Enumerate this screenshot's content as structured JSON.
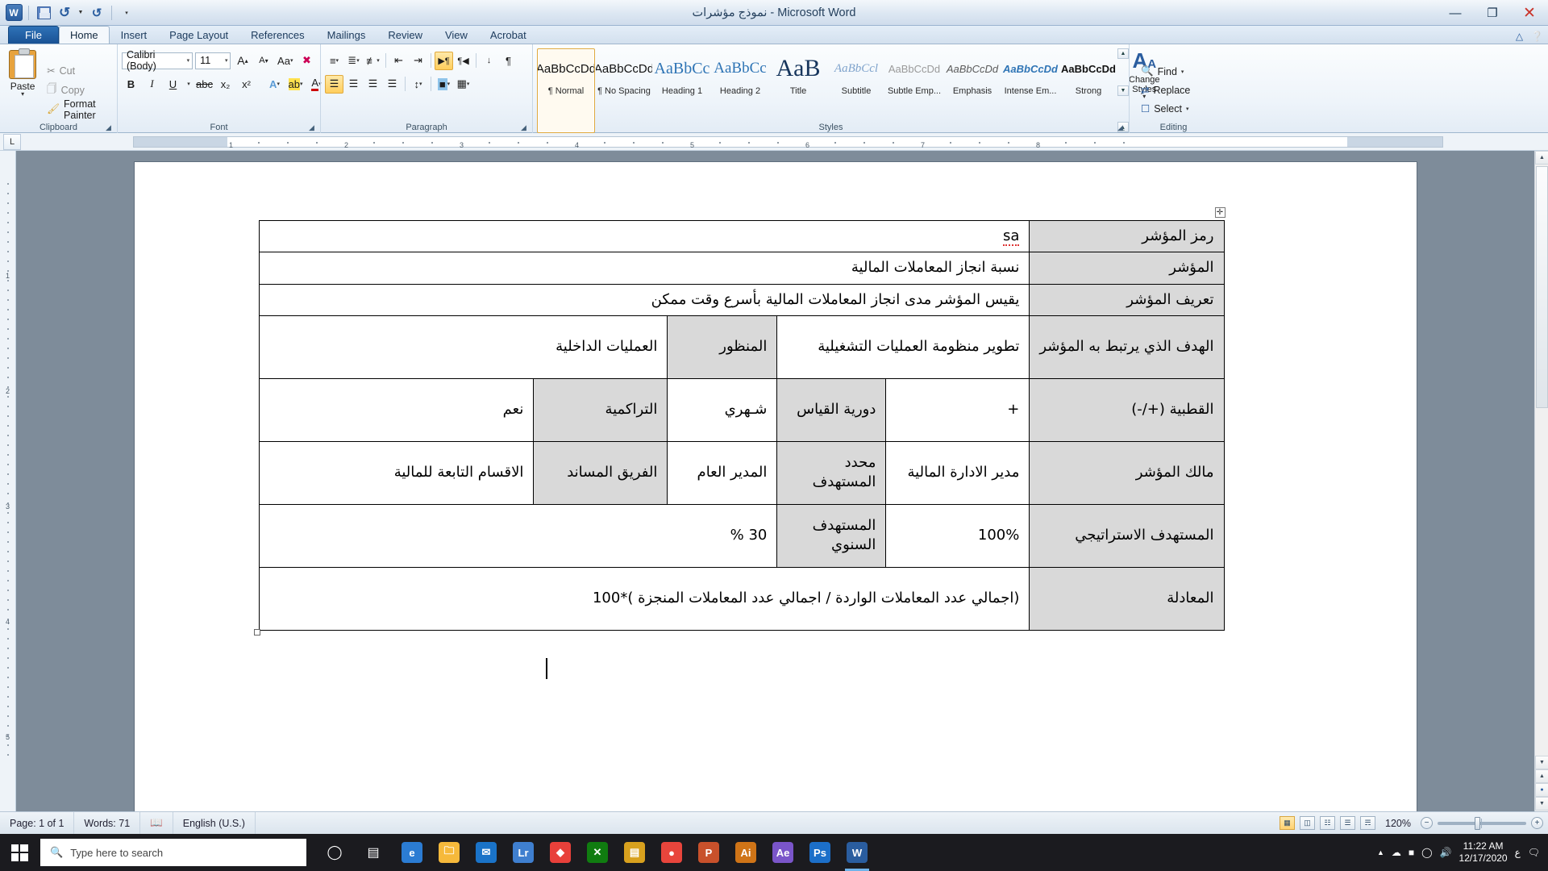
{
  "titlebar": {
    "title": "نموذج مؤشرات - Microsoft Word",
    "qat": {
      "word_logo": "W",
      "save": "save-icon",
      "undo": "undo-icon",
      "redo": "redo-icon",
      "customize": "customize-qat-icon"
    },
    "controls": {
      "minimize": "—",
      "restore": "❐",
      "close": "✕"
    }
  },
  "tabs": [
    {
      "label": "File",
      "active": false,
      "file": true
    },
    {
      "label": "Home",
      "active": true
    },
    {
      "label": "Insert",
      "active": false
    },
    {
      "label": "Page Layout",
      "active": false
    },
    {
      "label": "References",
      "active": false
    },
    {
      "label": "Mailings",
      "active": false
    },
    {
      "label": "Review",
      "active": false
    },
    {
      "label": "View",
      "active": false
    },
    {
      "label": "Acrobat",
      "active": false
    }
  ],
  "ribbon": {
    "clipboard": {
      "group_label": "Clipboard",
      "paste": "Paste",
      "cut": "Cut",
      "copy": "Copy",
      "format_painter": "Format Painter"
    },
    "font": {
      "group_label": "Font",
      "font_name": "Calibri (Body)",
      "font_size": "11",
      "grow": "A",
      "shrink": "A",
      "change_case": "Aa",
      "clear_formatting": "clear-formatting-icon",
      "bold": "B",
      "italic": "I",
      "underline": "U",
      "strikethrough": "abc",
      "subscript": "x₂",
      "superscript": "x²",
      "text_effects": "A",
      "highlight": "ab",
      "font_color": "A"
    },
    "paragraph": {
      "group_label": "Paragraph",
      "bullets": "bullets-icon",
      "numbering": "numbering-icon",
      "multilevel": "multilevel-list-icon",
      "decrease_indent": "decrease-indent-icon",
      "increase_indent": "increase-indent-icon",
      "ltr": "left-to-right-icon",
      "rtl": "right-to-left-icon",
      "sort": "sort-icon",
      "show_marks": "¶",
      "align_left": "align-left-icon",
      "align_center": "align-center-icon",
      "align_right": "align-right-icon",
      "justify": "justify-icon",
      "line_spacing": "line-spacing-icon",
      "shading": "shading-icon",
      "borders": "borders-icon"
    },
    "styles": {
      "group_label": "Styles",
      "items": [
        {
          "preview": "AaBbCcDd",
          "name": "¶ Normal",
          "selected": true
        },
        {
          "preview": "AaBbCcDd",
          "name": "¶ No Spacing",
          "selected": false
        },
        {
          "preview": "AaBbCc",
          "name": "Heading 1",
          "selected": false
        },
        {
          "preview": "AaBbCc",
          "name": "Heading 2",
          "selected": false
        },
        {
          "preview": "AaB",
          "name": "Title",
          "selected": false
        },
        {
          "preview": "AaBbCcl",
          "name": "Subtitle",
          "selected": false
        },
        {
          "preview": "AaBbCcDd",
          "name": "Subtle Emp...",
          "selected": false
        },
        {
          "preview": "AaBbCcDd",
          "name": "Emphasis",
          "selected": false
        },
        {
          "preview": "AaBbCcDd",
          "name": "Intense Em...",
          "selected": false
        },
        {
          "preview": "AaBbCcDd",
          "name": "Strong",
          "selected": false
        }
      ],
      "change_styles": "Change Styles"
    },
    "editing": {
      "group_label": "Editing",
      "find": "Find",
      "replace": "Replace",
      "select": "Select"
    }
  },
  "ruler": {
    "tab_selector": "L",
    "ticks": [
      "1",
      "2",
      "3",
      "4",
      "5",
      "6",
      "7",
      "8"
    ],
    "vticks": [
      "1",
      "2",
      "3",
      "4",
      "5"
    ]
  },
  "document": {
    "table": [
      {
        "cells": [
          {
            "text": "رمز المؤشر",
            "type": "label",
            "width": 170
          },
          {
            "text": "sa",
            "type": "value",
            "colspan": 5,
            "spell": true
          }
        ]
      },
      {
        "cells": [
          {
            "text": "المؤشر",
            "type": "label"
          },
          {
            "text": "نسبة انجاز المعاملات المالية",
            "type": "value",
            "colspan": 5
          }
        ]
      },
      {
        "cells": [
          {
            "text": "تعريف المؤشر",
            "type": "label"
          },
          {
            "text": "يقيس المؤشر مدى انجاز المعاملات المالية بأسرع وقت ممكن",
            "type": "value",
            "colspan": 5
          }
        ]
      },
      {
        "tall": true,
        "cells": [
          {
            "text": "الهدف الذي يرتبط به المؤشر",
            "type": "label"
          },
          {
            "text": "تطوير منظومة العمليات التشغيلية",
            "type": "value",
            "colspan": 2
          },
          {
            "text": "المنظور",
            "type": "shade"
          },
          {
            "text": "العمليات الداخلية",
            "type": "value",
            "colspan": 2
          }
        ]
      },
      {
        "tall": true,
        "cells": [
          {
            "text": "القطبية (+/-)",
            "type": "label"
          },
          {
            "text": "+",
            "type": "value"
          },
          {
            "text": "دورية القياس",
            "type": "shade"
          },
          {
            "text": "شـهري",
            "type": "value"
          },
          {
            "text": "التراكمية",
            "type": "shade"
          },
          {
            "text": "نعم",
            "type": "value"
          }
        ]
      },
      {
        "tall": true,
        "cells": [
          {
            "text": "مالك المؤشر",
            "type": "label"
          },
          {
            "text": "مدير الادارة المالية",
            "type": "value"
          },
          {
            "text": "محدد المستهدف",
            "type": "shade"
          },
          {
            "text": "المدير العام",
            "type": "value"
          },
          {
            "text": "الفريق المساند",
            "type": "shade"
          },
          {
            "text": "الاقسام التابعة للمالية",
            "type": "value"
          }
        ]
      },
      {
        "tall": true,
        "cells": [
          {
            "text": "المستهدف الاستراتيجي",
            "type": "label"
          },
          {
            "text": "100%",
            "type": "value"
          },
          {
            "text": "المستهدف السنوي",
            "type": "shade"
          },
          {
            "text": "30 %",
            "type": "value",
            "colspan": 3
          }
        ]
      },
      {
        "tall": true,
        "cells": [
          {
            "text": "المعادلة",
            "type": "label"
          },
          {
            "text": "(اجمالي عدد المعاملات الواردة / اجمالي عدد المعاملات المنجزة )*100",
            "type": "value",
            "colspan": 5
          }
        ]
      }
    ]
  },
  "statusbar": {
    "page": "Page: 1 of 1",
    "words": "Words: 71",
    "proofing_icon": "spelling-check-icon",
    "language": "English (U.S.)",
    "views": [
      "print-layout-icon",
      "full-screen-reading-icon",
      "web-layout-icon",
      "outline-icon",
      "draft-icon"
    ],
    "zoom": "120%",
    "zoom_out": "−",
    "zoom_in": "+"
  },
  "taskbar": {
    "start": "start-button",
    "search_placeholder": "Type here to search",
    "search_icon": "search-icon",
    "cortana": "cortana-icon",
    "task_view": "task-view-icon",
    "apps": [
      {
        "name": "edge-icon",
        "glyph": "e",
        "color": "#2b7cd3"
      },
      {
        "name": "file-explorer-icon",
        "glyph": "🗀",
        "color": "#f6b93b"
      },
      {
        "name": "mail-icon",
        "glyph": "✉",
        "color": "#1a73c8"
      },
      {
        "name": "lightroom-icon",
        "glyph": "Lr",
        "color": "#3f7fcf"
      },
      {
        "name": "brand-icon",
        "glyph": "◆",
        "color": "#e8403a"
      },
      {
        "name": "xbox-icon",
        "glyph": "✕",
        "color": "#107c10"
      },
      {
        "name": "store-icon",
        "glyph": "▤",
        "color": "#d8a11e"
      },
      {
        "name": "chrome-icon",
        "glyph": "●",
        "color": "#e8453c"
      },
      {
        "name": "powerpoint-icon",
        "glyph": "P",
        "color": "#c8512b"
      },
      {
        "name": "illustrator-icon",
        "glyph": "Ai",
        "color": "#cf7417"
      },
      {
        "name": "aftereffects-icon",
        "glyph": "Ae",
        "color": "#7a55c9"
      },
      {
        "name": "photoshop-icon",
        "glyph": "Ps",
        "color": "#1c6fc9"
      },
      {
        "name": "word-icon",
        "glyph": "W",
        "color": "#2a5d9f",
        "active": true
      }
    ],
    "tray": {
      "chevron": "▲",
      "cloud": "cloud-icon",
      "battery": "battery-icon",
      "wifi": "wifi-icon",
      "volume": "volume-icon",
      "time": "11:22 AM",
      "date": "12/17/2020",
      "lang": "ع",
      "notifications": "notifications-icon"
    }
  },
  "colors": {
    "accent": "#2a5d9f",
    "ribbon_bg": "#eef4fa",
    "shade": "#d9d9d9",
    "selection": "#ffce5c"
  }
}
